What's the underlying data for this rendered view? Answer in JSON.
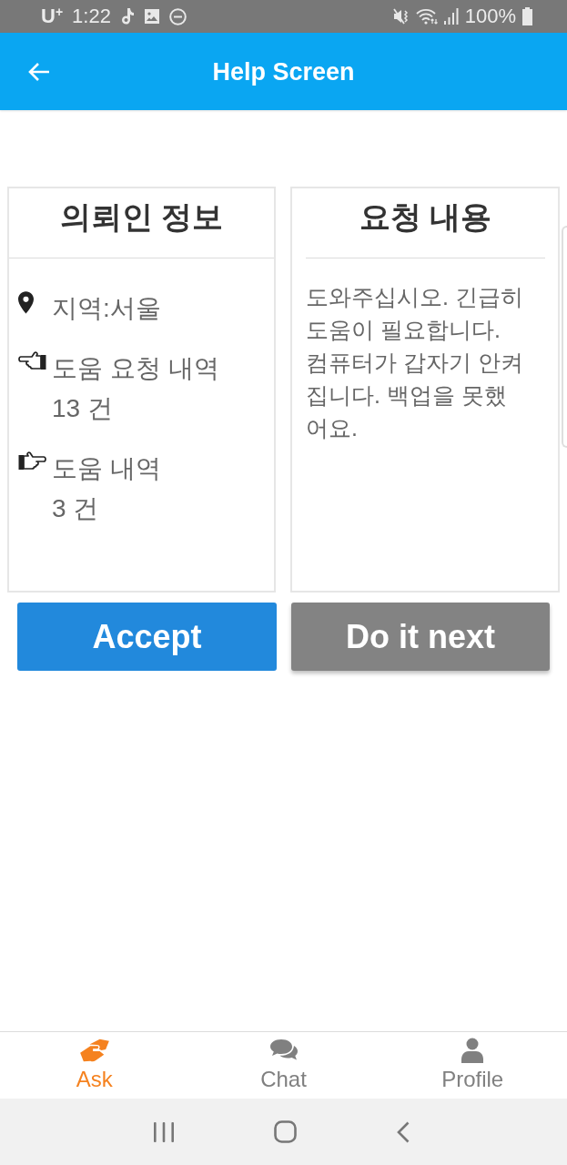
{
  "status_bar": {
    "carrier": "U$^{+}$",
    "time": "1:22",
    "battery": "100%"
  },
  "app_bar": {
    "title": "Help Screen"
  },
  "client_card": {
    "title": "의뢰인 정보",
    "items": [
      {
        "kind": "location",
        "label": "지역:서울"
      },
      {
        "kind": "requested",
        "label": "도움 요청 내역",
        "count": "13 건"
      },
      {
        "kind": "helped",
        "label": "도움 내역",
        "count": "3 건"
      }
    ]
  },
  "request_card": {
    "title": "요청 내용",
    "body": "도와주십시오. 긴급히\n도움이 필요합니다.\n컴퓨터가 갑자기 안켜\n집니다. 백업을 못했\n어요."
  },
  "actions": [
    {
      "kind": "accept",
      "label": "Accept"
    },
    {
      "kind": "defer",
      "label": "Do it next"
    }
  ],
  "bottom_nav": [
    {
      "kind": "handshake",
      "label": "Ask",
      "selected": true
    },
    {
      "kind": "chat",
      "label": "Chat",
      "selected": false
    },
    {
      "kind": "person",
      "label": "Profile",
      "selected": false
    }
  ]
}
